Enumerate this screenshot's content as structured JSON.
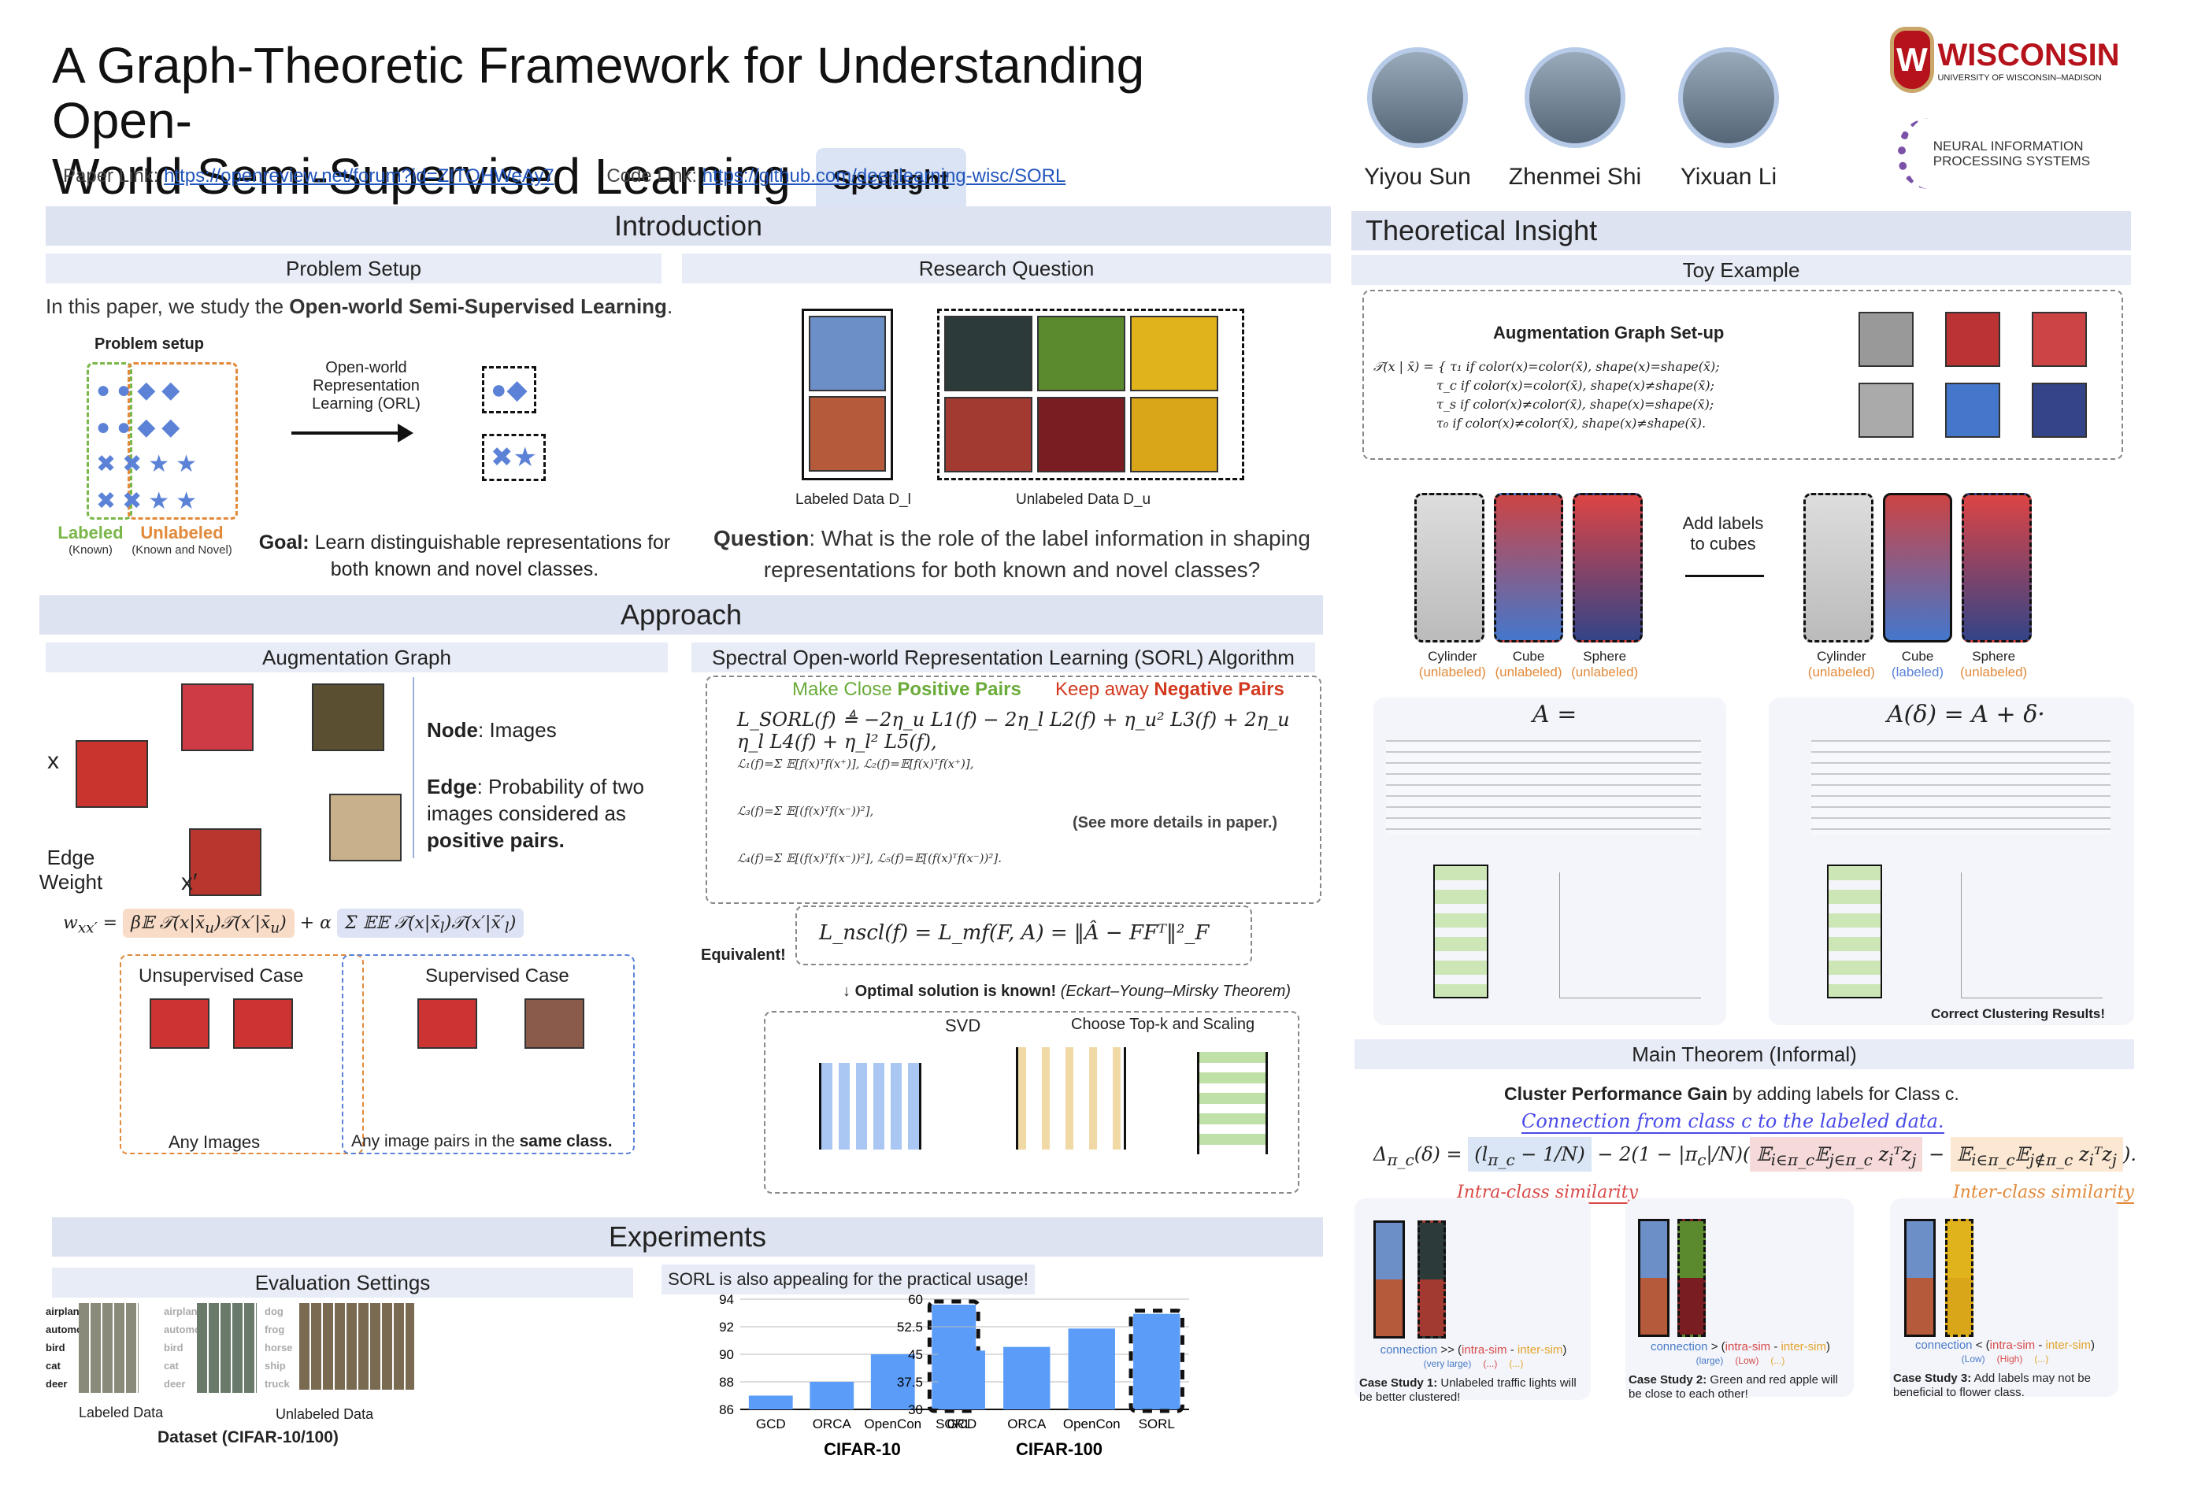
{
  "header": {
    "title_line1": "A Graph-Theoretic Framework for Understanding Open-",
    "title_line2": "World Semi-Supervised Learning",
    "badge": "Spotlight",
    "paper_label": "Paper Link:",
    "paper_url": "https://openreview.net/forum?id=ZITOHWeAy7",
    "code_label": "Code Link:",
    "code_url": "https://github.com/deeplearning-wisc/SORL",
    "authors": [
      "Yiyou Sun",
      "Zhenmei Shi",
      "Yixuan Li"
    ],
    "logo1": "WISCONSIN",
    "logo1_sub": "UNIVERSITY OF WISCONSIN–MADISON",
    "logo2_line1": "NEURAL INFORMATION",
    "logo2_line2": "PROCESSING SYSTEMS"
  },
  "intro": {
    "heading": "Introduction",
    "problem_setup": "Problem Setup",
    "research_question": "Research Question",
    "intro_text_pre": "In this paper, we study the ",
    "intro_text_bold": "Open-world Semi-Supervised Learning",
    "problem_setup_label": "Problem setup",
    "orl_label": "Open-world Representation Learning (ORL)",
    "labeled": "Labeled",
    "labeled_sub": "(Known)",
    "unlabeled": "Unlabeled",
    "unlabeled_sub": "(Known and Novel)",
    "goal_bold": "Goal:",
    "goal_text": " Learn distinguishable representations for both known and novel classes.",
    "labeled_data": "Labeled Data D_l",
    "unlabeled_data": "Unlabeled Data D_u",
    "question_bold": "Question",
    "question_text": ": What is the role of the label information in shaping representations for both known and novel classes?"
  },
  "approach": {
    "heading": "Approach",
    "aug_graph": "Augmentation Graph",
    "sorl_title": "Spectral Open-world Representation Learning (SORL) Algorithm",
    "node_bold": "Node",
    "node_text": ": Images",
    "edge_bold": "Edge",
    "edge_text": ": Probability of two images considered as ",
    "edge_bold2": "positive pairs.",
    "edge_weight": "Edge Weight",
    "unsup": "Unsupervised Case",
    "sup": "Supervised Case",
    "any_images": "Any Images",
    "any_pairs": "Any image pairs in the ",
    "same_class": "same class.",
    "make_close": "Make Close ",
    "positive_pairs": "Positive Pairs",
    "keep_away": "Keep away ",
    "negative_pairs": "Negative Pairs",
    "loss": "L_SORL(f) ≜ −2η_u L1(f) − 2η_l L2(f) + η_u² L3(f) + 2η_u η_l L4(f) + η_l² L5(f),",
    "see_more": "(See more details in paper.)",
    "equivalent": "Equivalent!",
    "nscl": "L_nscl(f) = L_mf(F, A) = ‖Â − FFᵀ‖²_F",
    "optimal": "Optimal solution is known!",
    "eym": "(Eckart–Young–Mirsky Theorem)",
    "svd": "SVD",
    "topk": "Choose Top-k and Scaling"
  },
  "experiments": {
    "heading": "Experiments",
    "eval": "Evaluation Settings",
    "practical": "SORL is also appealing for the practical usage!",
    "classes_labeled": [
      "airplane",
      "automobile",
      "bird",
      "cat",
      "deer"
    ],
    "classes_novel": [
      "dog",
      "frog",
      "horse",
      "ship",
      "truck"
    ],
    "labeled_data": "Labeled Data",
    "unlabeled_data": "Unlabeled Data",
    "dataset": "Dataset (CIFAR-10/100)"
  },
  "chart_data": [
    {
      "type": "bar",
      "title": "CIFAR-10",
      "categories": [
        "GCD",
        "ORCA",
        "OpenCon",
        "SORL"
      ],
      "values": [
        87.0,
        88.0,
        90.0,
        93.6
      ],
      "ylim": [
        86,
        94
      ],
      "yticks": [
        "86",
        "88",
        "90",
        "92",
        "94"
      ],
      "highlight": "SORL",
      "grid": true
    },
    {
      "type": "bar",
      "title": "CIFAR-100",
      "categories": [
        "GCD",
        "ORCA",
        "OpenCon",
        "SORL"
      ],
      "values": [
        46.0,
        47.0,
        52.0,
        56.0
      ],
      "ylim": [
        30,
        60
      ],
      "yticks": [
        "30",
        "37.5",
        "45",
        "52.5",
        "60"
      ],
      "highlight": "SORL",
      "grid": true
    }
  ],
  "theory": {
    "heading": "Theoretical Insight",
    "toy": "Toy Example",
    "aug_setup": "Augmentation Graph Set-up",
    "add_labels": "Add labels to cubes",
    "shapes": [
      "Cylinder",
      "Cube",
      "Sphere"
    ],
    "status_before": [
      "(unlabeled)",
      "(unlabeled)",
      "(unlabeled)"
    ],
    "status_after": [
      "(unlabeled)",
      "(labeled)",
      "(unlabeled)"
    ],
    "A_eq": "A =",
    "Ad_eq": "A(δ) = A + δ·",
    "correct": "Correct Clustering Results!",
    "main_theorem": "Main Theorem (Informal)",
    "gain_bold": "Cluster Performance Gain",
    "gain_text": " by adding labels for Class c.",
    "connection_note": "Connection from class c to the labeled data.",
    "intra_note": "Intra-class similarity",
    "inter_note": "Inter-class similarity",
    "cases": [
      {
        "op": ">>",
        "c": "(very large)",
        "a": "(...)",
        "b": "(...)",
        "bold": "Case Study 1:",
        "text": " Unlabeled traffic lights will be better clustered!"
      },
      {
        "op": ">",
        "c": "(large)",
        "a": "(Low)",
        "b": "(...)",
        "bold": "Case Study 2:",
        "text": " Green and red apple will be close to each other!"
      },
      {
        "op": "<",
        "c": "(Low)",
        "a": "(High)",
        "b": "(...)",
        "bold": "Case Study 3:",
        "text": " Add labels may not be beneficial to flower class."
      }
    ]
  }
}
